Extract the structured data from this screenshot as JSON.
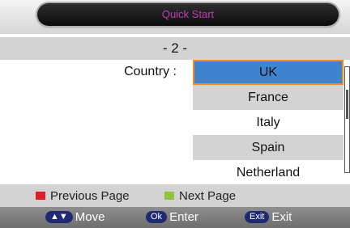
{
  "title": "Quick Start",
  "page_indicator": "- 2 -",
  "country_label": "Country :",
  "countries": [
    {
      "label": "UK",
      "state": "selected"
    },
    {
      "label": "France",
      "state": "shaded"
    },
    {
      "label": "Italy",
      "state": "plain"
    },
    {
      "label": "Spain",
      "state": "shaded"
    },
    {
      "label": "Netherland",
      "state": "plain"
    }
  ],
  "legend": {
    "previous": "Previous Page",
    "next": "Next Page"
  },
  "help": {
    "move_key": "▲▼",
    "move_label": "Move",
    "enter_key": "Ok",
    "enter_label": "Enter",
    "exit_key": "Exit",
    "exit_label": "Exit"
  },
  "colors": {
    "selected_fill": "#3f84cf",
    "selected_border": "#f08a1a",
    "title_text": "#c23ab8",
    "previous_button": "#e01d2c",
    "next_button": "#8fc43f",
    "key_badge": "#1f2a73"
  }
}
